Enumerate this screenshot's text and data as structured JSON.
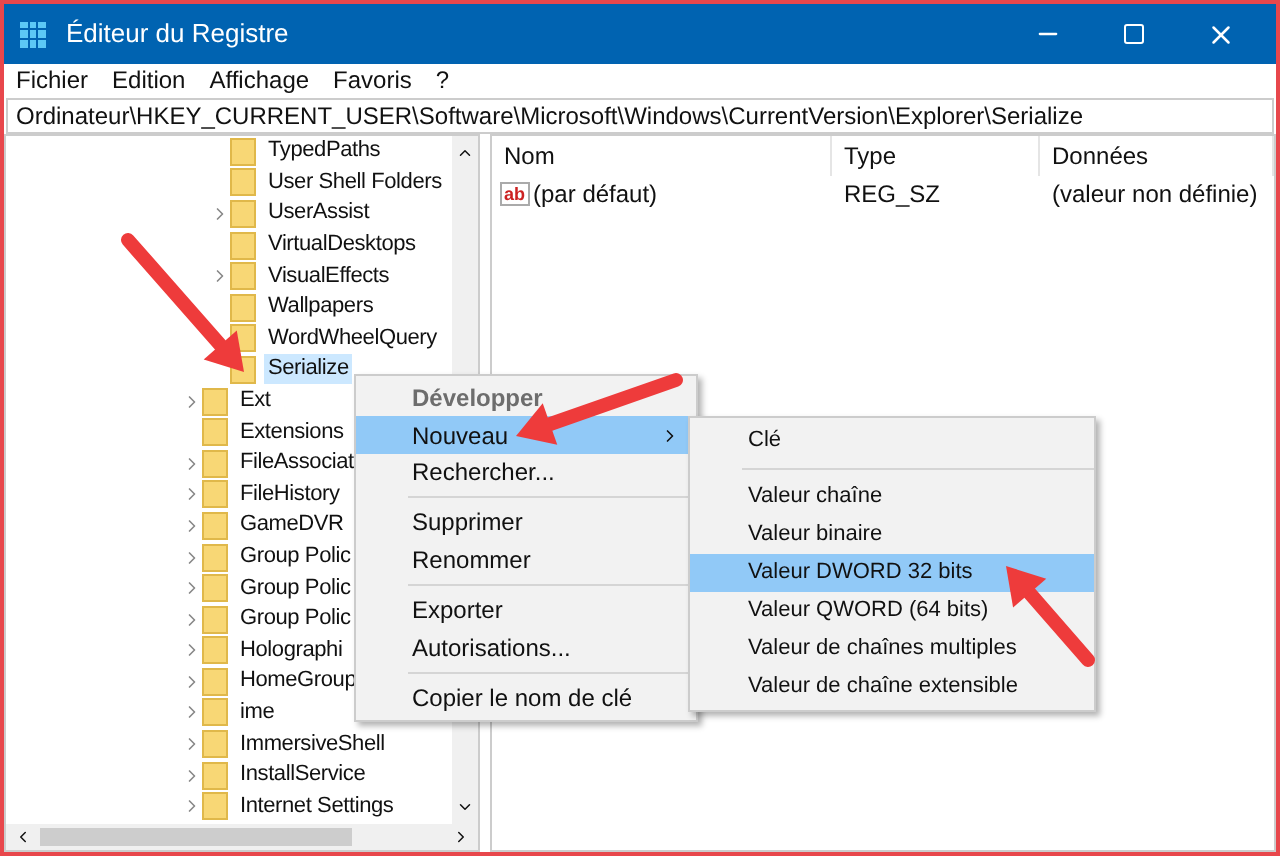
{
  "window": {
    "title": "Éditeur du Registre"
  },
  "menu": [
    "Fichier",
    "Edition",
    "Affichage",
    "Favoris",
    "?"
  ],
  "address": "Ordinateur\\HKEY_CURRENT_USER\\Software\\Microsoft\\Windows\\CurrentVersion\\Explorer\\Serialize",
  "tree": {
    "items": [
      {
        "children": [
          {
            "label": "TypedPaths",
            "expandable": false,
            "selected": false
          },
          {
            "label": "User Shell Folders",
            "expandable": false,
            "selected": false
          },
          {
            "label": "UserAssist",
            "expandable": true,
            "selected": false
          },
          {
            "label": "VirtualDesktops",
            "expandable": false,
            "selected": false
          },
          {
            "label": "VisualEffects",
            "expandable": true,
            "selected": false
          },
          {
            "label": "Wallpapers",
            "expandable": false,
            "selected": false
          },
          {
            "label": "WordWheelQuery",
            "expandable": false,
            "selected": false
          },
          {
            "label": "Serialize",
            "expandable": false,
            "selected": true
          }
        ]
      },
      {
        "label": "Ext",
        "expandable": true,
        "selected": false
      },
      {
        "label": "Extensions",
        "expandable": false,
        "selected": false
      },
      {
        "label": "FileAssociat",
        "expandable": true,
        "selected": false
      },
      {
        "label": "FileHistory",
        "expandable": true,
        "selected": false
      },
      {
        "label": "GameDVR",
        "expandable": true,
        "selected": false
      },
      {
        "label": "Group Polic",
        "expandable": true,
        "selected": false
      },
      {
        "label": "Group Polic",
        "expandable": true,
        "selected": false
      },
      {
        "label": "Group Polic",
        "expandable": true,
        "selected": false
      },
      {
        "label": "Holographi",
        "expandable": true,
        "selected": false
      },
      {
        "label": "HomeGroup",
        "expandable": true,
        "selected": false
      },
      {
        "label": "ime",
        "expandable": true,
        "selected": false
      },
      {
        "label": "ImmersiveShell",
        "expandable": true,
        "selected": false
      },
      {
        "label": "InstallService",
        "expandable": true,
        "selected": false
      },
      {
        "label": "Internet Settings",
        "expandable": true,
        "selected": false
      }
    ]
  },
  "values": {
    "columns": [
      "Nom",
      "Type",
      "Données"
    ],
    "rows": [
      {
        "icon": "ab",
        "name": "(par défaut)",
        "type": "REG_SZ",
        "data": "(valeur non définie)"
      }
    ]
  },
  "context_menu": [
    {
      "kind": "item",
      "label": "Développer",
      "default": true,
      "disabled": true,
      "selected": false,
      "submenu": false
    },
    {
      "kind": "item",
      "label": "Nouveau",
      "default": false,
      "disabled": false,
      "selected": true,
      "submenu": true
    },
    {
      "kind": "item",
      "label": "Rechercher...",
      "default": false,
      "disabled": false,
      "selected": false,
      "submenu": false
    },
    {
      "kind": "separator"
    },
    {
      "kind": "item",
      "label": "Supprimer",
      "default": false,
      "disabled": false,
      "selected": false,
      "submenu": false
    },
    {
      "kind": "item",
      "label": "Renommer",
      "default": false,
      "disabled": false,
      "selected": false,
      "submenu": false
    },
    {
      "kind": "separator"
    },
    {
      "kind": "item",
      "label": "Exporter",
      "default": false,
      "disabled": false,
      "selected": false,
      "submenu": false
    },
    {
      "kind": "item",
      "label": "Autorisations...",
      "default": false,
      "disabled": false,
      "selected": false,
      "submenu": false
    },
    {
      "kind": "separator"
    },
    {
      "kind": "item",
      "label": "Copier le nom de clé",
      "default": false,
      "disabled": false,
      "selected": false,
      "submenu": false
    }
  ],
  "submenu": [
    {
      "kind": "item",
      "label": "Clé",
      "selected": false
    },
    {
      "kind": "separator"
    },
    {
      "kind": "item",
      "label": "Valeur chaîne",
      "selected": false
    },
    {
      "kind": "item",
      "label": "Valeur binaire",
      "selected": false
    },
    {
      "kind": "item",
      "label": "Valeur DWORD 32 bits",
      "selected": true
    },
    {
      "kind": "item",
      "label": "Valeur QWORD (64 bits)",
      "selected": false
    },
    {
      "kind": "item",
      "label": "Valeur de chaînes multiples",
      "selected": false
    },
    {
      "kind": "item",
      "label": "Valeur de chaîne extensible",
      "selected": false
    }
  ]
}
